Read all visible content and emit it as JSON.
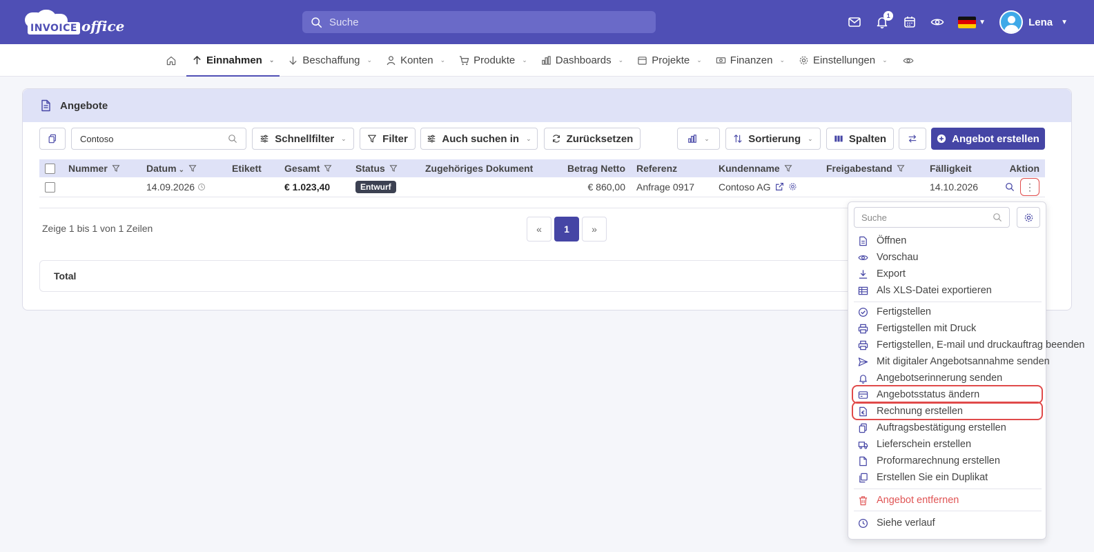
{
  "header": {
    "logo_word1": "INVOICE",
    "logo_word2": "office",
    "search_placeholder": "Suche",
    "notification_count": "1",
    "user_name": "Lena",
    "brand_color": "#4f4fb5"
  },
  "nav": {
    "items": [
      {
        "label": "Einnahmen",
        "icon": "arrow-up-icon",
        "active": true
      },
      {
        "label": "Beschaffung",
        "icon": "arrow-down-icon"
      },
      {
        "label": "Konten",
        "icon": "person-icon"
      },
      {
        "label": "Produkte",
        "icon": "cart-icon"
      },
      {
        "label": "Dashboards",
        "icon": "bar-chart-icon"
      },
      {
        "label": "Projekte",
        "icon": "calendar-icon"
      },
      {
        "label": "Finanzen",
        "icon": "money-icon"
      },
      {
        "label": "Einstellungen",
        "icon": "gear-icon"
      }
    ]
  },
  "card": {
    "title": "Angebote"
  },
  "toolbar": {
    "search_value": "Contoso",
    "quickfilter": "Schnellfilter",
    "filter": "Filter",
    "search_in": "Auch suchen in",
    "reset": "Zurücksetzen",
    "sorting": "Sortierung",
    "columns": "Spalten",
    "create": "Angebot erstellen"
  },
  "table": {
    "headers": {
      "number": "Nummer",
      "date": "Datum",
      "label": "Etikett",
      "total": "Gesamt",
      "status": "Status",
      "related_doc": "Zugehöriges Dokument",
      "net": "Betrag Netto",
      "reference": "Referenz",
      "customer": "Kundenname",
      "release": "Freigabestand",
      "due": "Fälligkeit",
      "action": "Aktion"
    },
    "row": {
      "number": "",
      "date": "14.09.2026",
      "label": "",
      "total": "€ 1.023,40",
      "status": "Entwurf",
      "related_doc": "",
      "net": "€ 860,00",
      "reference": "Anfrage 0917",
      "customer": "Contoso AG",
      "release": "",
      "due": "14.10.2026"
    }
  },
  "footer": {
    "rows_info": "Zeige 1 bis 1 von 1 Zeilen",
    "pager_prev": "«",
    "pager_current": "1",
    "pager_next": "»",
    "total_label": "Total"
  },
  "menu": {
    "search_placeholder": "Suche",
    "items": {
      "open": "Öffnen",
      "preview": "Vorschau",
      "export": "Export",
      "xls": "Als XLS-Datei exportieren",
      "finalize": "Fertigstellen",
      "finalize_print": "Fertigstellen mit Druck",
      "finalize_email": "Fertigstellen, E-mail und druckauftrag beenden",
      "digital_send": "Mit digitaler Angebotsannahme senden",
      "reminder": "Angebotserinnerung senden",
      "change_status": "Angebotsstatus ändern",
      "create_invoice": "Rechnung erstellen",
      "order_confirm": "Auftragsbestätigung erstellen",
      "delivery_note": "Lieferschein erstellen",
      "proforma": "Proformarechnung erstellen",
      "duplicate": "Erstellen Sie ein Duplikat",
      "delete": "Angebot entfernen",
      "history": "Siehe verlauf"
    },
    "danger_color": "#e05555",
    "highlight_color": "#e04a4a"
  }
}
